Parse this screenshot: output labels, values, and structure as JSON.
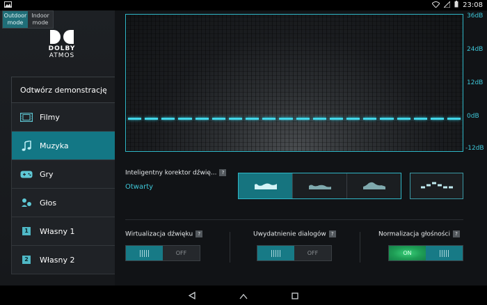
{
  "status_bar": {
    "time": "23:08",
    "icons": [
      "picture-icon",
      "wifi-icon",
      "signal-icon",
      "battery-icon"
    ]
  },
  "mode_toggle": {
    "outdoor": "Outdoor\nmode",
    "indoor": "Indoor\nmode",
    "selected": "outdoor"
  },
  "logo": {
    "brand": "DOLBY",
    "sub": "ATMOS"
  },
  "sidebar": {
    "demo_label": "Odtwórz demonstrację",
    "items": [
      {
        "label": "Filmy",
        "icon": "film-icon",
        "active": false
      },
      {
        "label": "Muzyka",
        "icon": "music-note-icon",
        "active": true
      },
      {
        "label": "Gry",
        "icon": "gamepad-icon",
        "active": false
      },
      {
        "label": "Głos",
        "icon": "voice-icon",
        "active": false
      },
      {
        "label": "Własny 1",
        "icon": "number-1-icon",
        "badge": "1",
        "active": false
      },
      {
        "label": "Własny 2",
        "icon": "number-2-icon",
        "badge": "2",
        "active": false
      }
    ]
  },
  "equalizer": {
    "db_labels": [
      "36dB",
      "24dB",
      "12dB",
      "0dB",
      "-12dB"
    ],
    "band_count": 20,
    "band_level_db": 0
  },
  "intelligent_eq": {
    "label": "Inteligentny korektor dźwię...",
    "help": "?",
    "value": "Otwarty",
    "presets": [
      "preset-open-icon",
      "preset-rich-icon",
      "preset-focused-icon"
    ],
    "selected_preset": 0,
    "custom_icon": "custom-eq-icon"
  },
  "controls": {
    "virtualization": {
      "label": "Wirtualizacja dźwięku",
      "help": "?",
      "state": "OFF",
      "off_label": "OFF"
    },
    "dialog": {
      "label": "Uwydatnienie dialogów",
      "help": "?",
      "state": "OFF",
      "off_label": "OFF"
    },
    "normalization": {
      "label": "Normalizacja głośności",
      "help": "?",
      "state": "ON",
      "on_label": "ON"
    }
  },
  "colors": {
    "accent": "#2fb8c8",
    "active_item": "#137785",
    "on_green": "#1e9d55"
  }
}
